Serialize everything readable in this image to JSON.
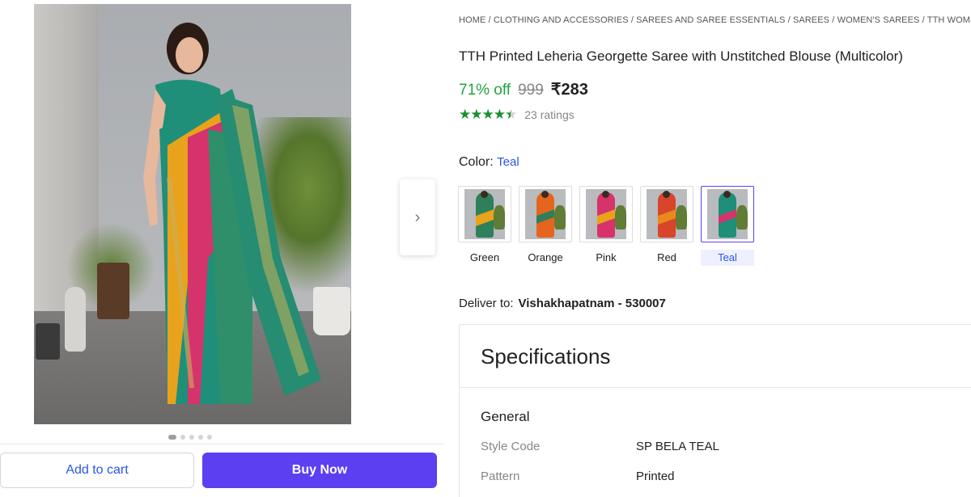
{
  "gallery": {
    "dots_count": 5,
    "active_dot": 0,
    "next_icon": "chevron-right-icon"
  },
  "actions": {
    "add_to_cart": "Add to cart",
    "buy_now": "Buy Now"
  },
  "breadcrumb": "HOME / CLOTHING AND ACCESSORIES / SAREES AND SAREE ESSENTIALS / SAREES / WOMEN'S SAREES / TTH WOMEN'S SAREES",
  "product": {
    "title": "TTH Printed Leheria Georgette Saree with Unstitched Blouse (Multicolor)",
    "discount": "71% off",
    "mrp": "999",
    "price": "₹283",
    "rating_stars": 4.5,
    "ratings_text": "23 ratings"
  },
  "color": {
    "label": "Color:",
    "selected": "Teal",
    "options": [
      {
        "name": "Green",
        "accent": "#2f7f5a",
        "second": "#e8a21c"
      },
      {
        "name": "Orange",
        "accent": "#e5651f",
        "second": "#2f7f5a"
      },
      {
        "name": "Pink",
        "accent": "#d6336c",
        "second": "#e8a21c"
      },
      {
        "name": "Red",
        "accent": "#d8452b",
        "second": "#e88a1c"
      },
      {
        "name": "Teal",
        "accent": "#1f8f7a",
        "second": "#d6336c"
      }
    ]
  },
  "delivery": {
    "label": "Deliver to:",
    "location": "Vishakhapatnam - 530007"
  },
  "specifications": {
    "heading": "Specifications",
    "group": "General",
    "rows": [
      {
        "key": "Style Code",
        "value": "SP BELA TEAL"
      },
      {
        "key": "Pattern",
        "value": "Printed"
      }
    ]
  },
  "colors": {
    "accent": "#5b3ff0",
    "link": "#2a55e5",
    "discount": "#24a33f",
    "star": "#1a8f2e"
  }
}
